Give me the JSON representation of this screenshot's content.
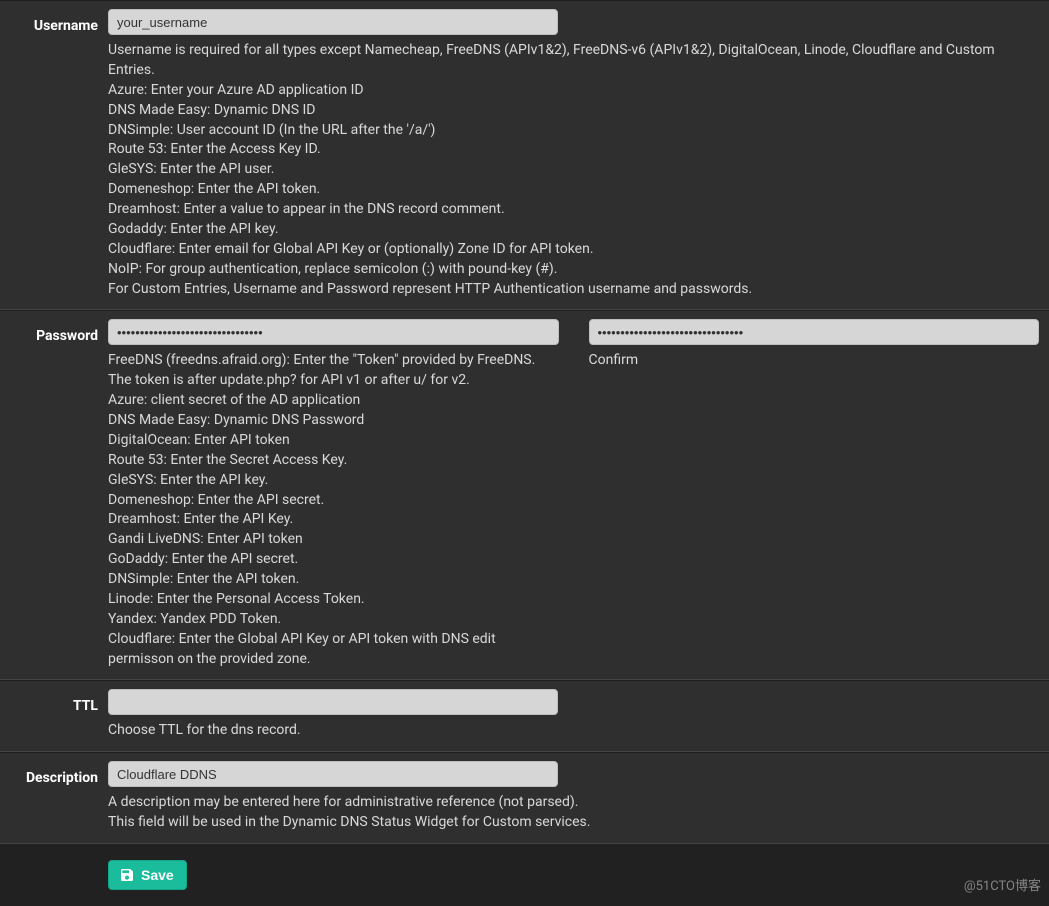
{
  "username": {
    "label": "Username",
    "value": "your_username",
    "help": [
      "Username is required for all types except Namecheap, FreeDNS (APIv1&2), FreeDNS-v6 (APIv1&2), DigitalOcean, Linode, Cloudflare and Custom Entries.",
      "Azure: Enter your Azure AD application ID",
      "DNS Made Easy: Dynamic DNS ID",
      "DNSimple: User account ID (In the URL after the '/a/')",
      "Route 53: Enter the Access Key ID.",
      "GleSYS: Enter the API user.",
      "Domeneshop: Enter the API token.",
      "Dreamhost: Enter a value to appear in the DNS record comment.",
      "Godaddy: Enter the API key.",
      "Cloudflare: Enter email for Global API Key or (optionally) Zone ID for API token.",
      "NoIP: For group authentication, replace semicolon (:) with pound-key (#).",
      "For Custom Entries, Username and Password represent HTTP Authentication username and passwords."
    ]
  },
  "password": {
    "label": "Password",
    "value": "••••••••••••••••••••••••••••••••",
    "confirm_value": "••••••••••••••••••••••••••••••••",
    "confirm_label": "Confirm",
    "help": [
      "FreeDNS (freedns.afraid.org): Enter the \"Token\" provided by FreeDNS. The token is after update.php? for API v1 or after u/ for v2.",
      "Azure: client secret of the AD application",
      "DNS Made Easy: Dynamic DNS Password",
      "DigitalOcean: Enter API token",
      "Route 53: Enter the Secret Access Key.",
      "GleSYS: Enter the API key.",
      "Domeneshop: Enter the API secret.",
      "Dreamhost: Enter the API Key.",
      "Gandi LiveDNS: Enter API token",
      "GoDaddy: Enter the API secret.",
      "DNSimple: Enter the API token.",
      "Linode: Enter the Personal Access Token.",
      "Yandex: Yandex PDD Token.",
      "Cloudflare: Enter the Global API Key or API token with DNS edit permisson on the provided zone."
    ]
  },
  "ttl": {
    "label": "TTL",
    "value": "",
    "help": [
      "Choose TTL for the dns record."
    ]
  },
  "description": {
    "label": "Description",
    "value": "Cloudflare DDNS",
    "help": [
      "A description may be entered here for administrative reference (not parsed).",
      "This field will be used in the Dynamic DNS Status Widget for Custom services."
    ]
  },
  "footer": {
    "save_label": "Save",
    "watermark": "@51CTO博客"
  }
}
